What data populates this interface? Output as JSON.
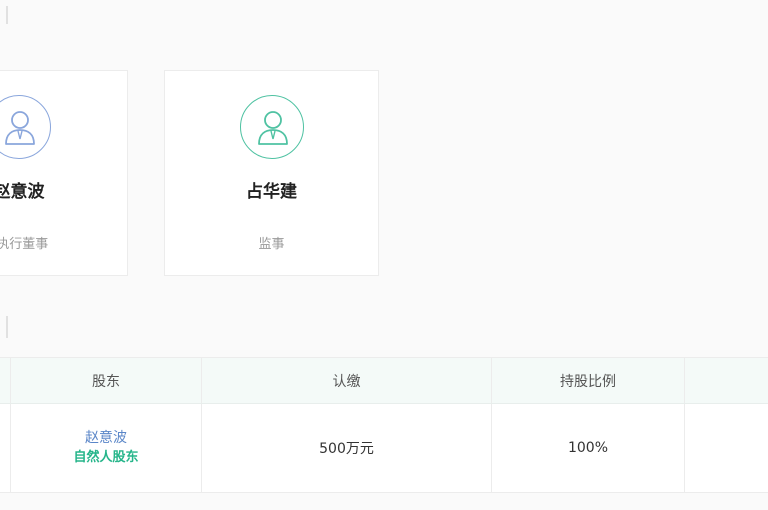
{
  "persons": [
    {
      "name": "赵意波",
      "role": "_执行董事",
      "avatar_icon": "user-icon",
      "accent": "#8aa6dc"
    },
    {
      "name": "占华建",
      "role": "监事",
      "avatar_icon": "user-icon",
      "accent": "#4fc2a2"
    }
  ],
  "table": {
    "headers": [
      "股东",
      "认缴",
      "持股比例"
    ],
    "rows": [
      {
        "shareholder_name": "赵意波",
        "shareholder_type": "自然人股东",
        "subscribed": "500万元",
        "ratio": "100%"
      }
    ]
  },
  "colors": {
    "link_blue": "#5a86c8",
    "tag_green": "#26b58a",
    "header_bg": "#f4faf8"
  }
}
